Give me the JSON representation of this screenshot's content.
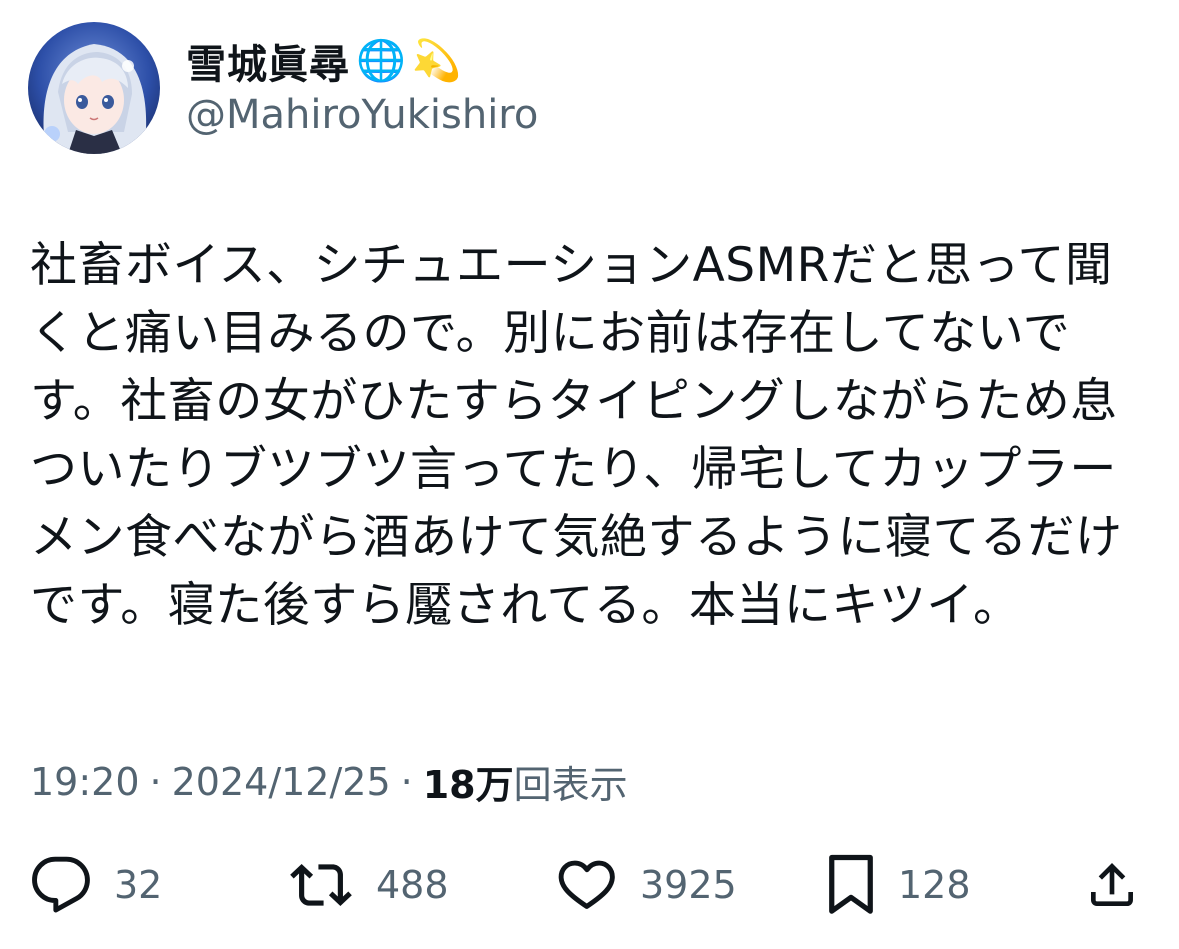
{
  "author": {
    "display_name": "雪城眞尋",
    "badge_emojis": [
      "🌐",
      "💫"
    ],
    "handle": "@MahiroYukishiro",
    "avatar": "avatar-image"
  },
  "tweet": {
    "text": "社畜ボイス、シチュエーションASMRだと思って聞くと痛い目みるので。別にお前は存在してないです。社畜の女がひたすらタイピングしながらため息ついたりブツブツ言ってたり、帰宅してカップラーメン食べながら酒あけて気絶するように寝てるだけです。寝た後すら魘されてる。本当にキツイ。"
  },
  "meta": {
    "time": "19:20",
    "separator": "·",
    "date": "2024/12/25",
    "views_count": "18万",
    "views_label": "回表示"
  },
  "actions": {
    "reply": {
      "icon": "reply-icon",
      "count": "32"
    },
    "repost": {
      "icon": "repost-icon",
      "count": "488"
    },
    "like": {
      "icon": "heart-icon",
      "count": "3925"
    },
    "bookmark": {
      "icon": "bookmark-icon",
      "count": "128"
    },
    "share": {
      "icon": "share-icon"
    }
  },
  "colors": {
    "text": "#0f1419",
    "secondary": "#536471",
    "background": "#ffffff"
  }
}
